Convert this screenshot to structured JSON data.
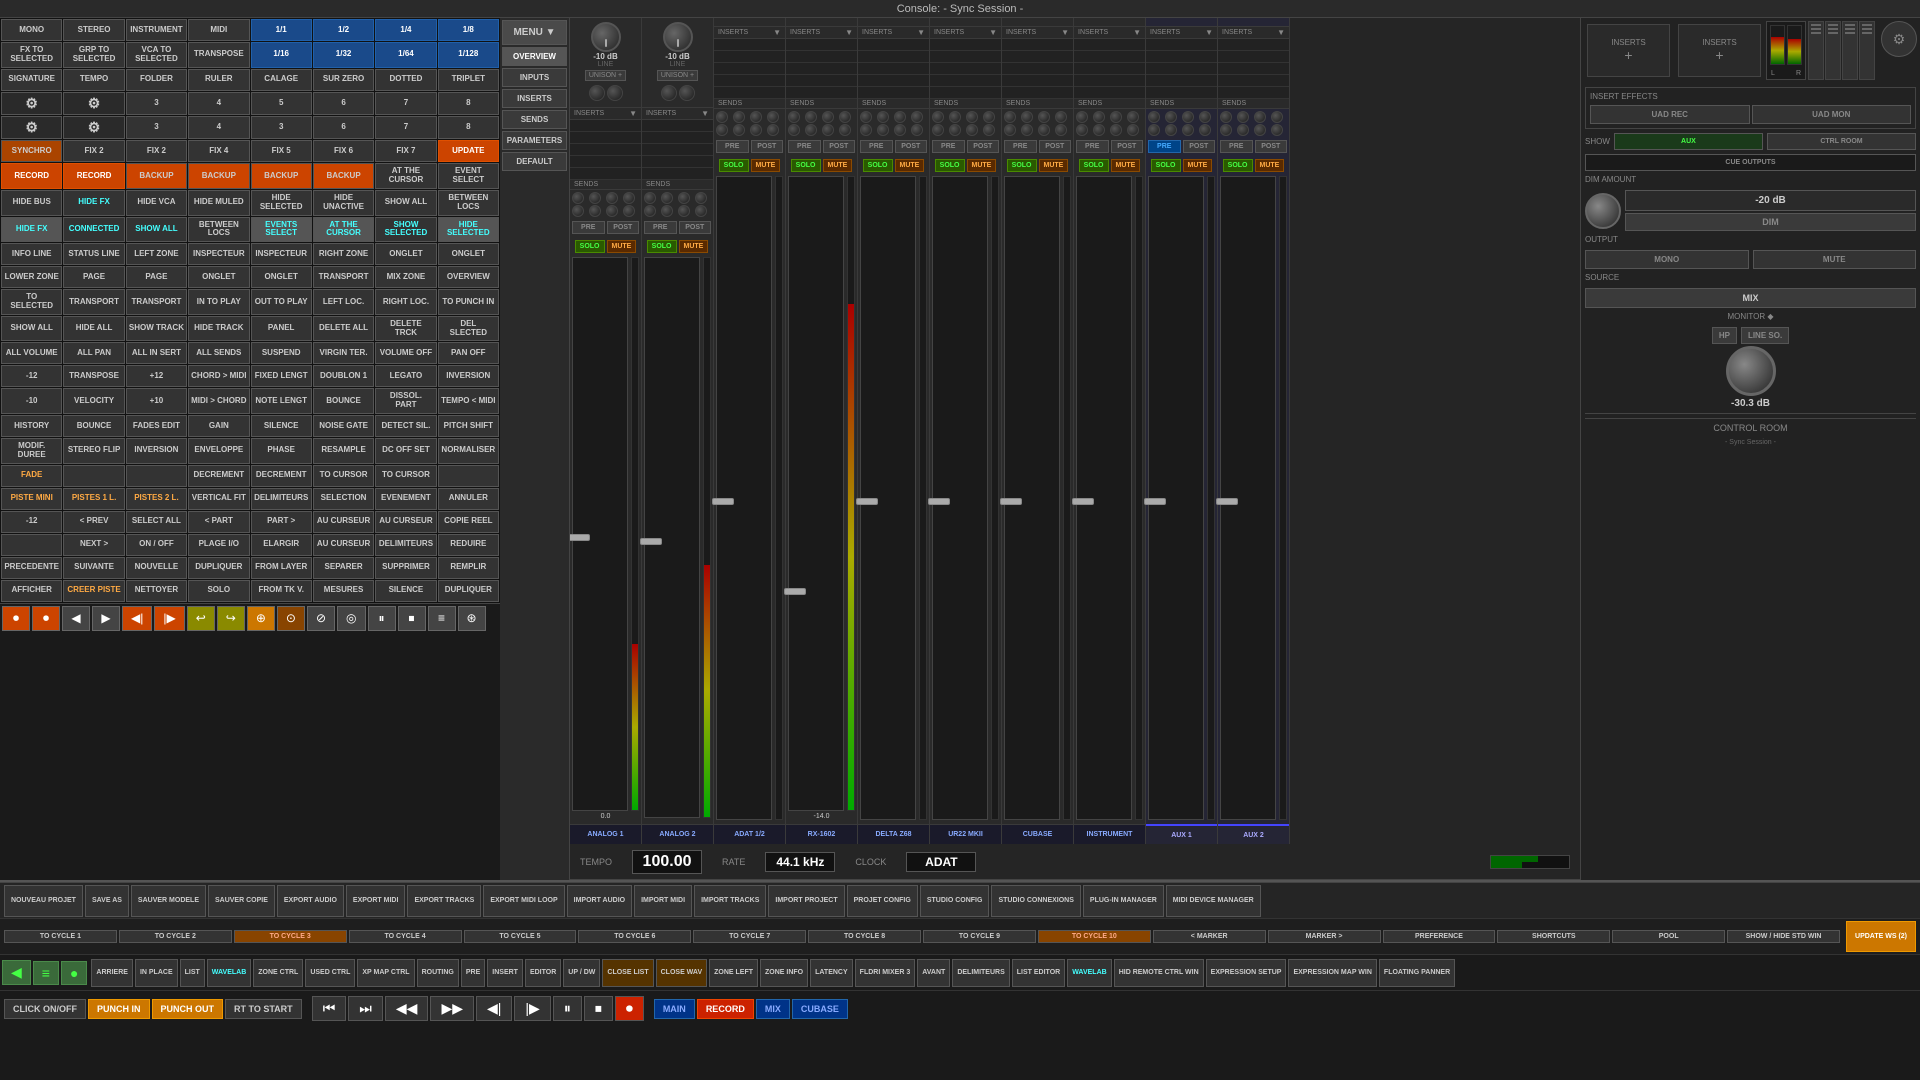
{
  "app": {
    "title": "Console: - Sync Session -",
    "topbar_color": "#2a2a2a"
  },
  "left_panel": {
    "rows": [
      [
        "MONO",
        "STEREO",
        "INSTRUMENT",
        "MIDI",
        "1/1",
        "1/2",
        "1/4",
        "1/8"
      ],
      [
        "FX TO Selected",
        "GRP TO Selected",
        "VCA TO Selected",
        "TRANSPOSE",
        "1/16",
        "1/32",
        "1/64",
        "1/128"
      ],
      [
        "SIGNATURE",
        "TEMPO",
        "FOLDER",
        "RULER",
        "CALAGE",
        "SUR ZERO",
        "DOTTED",
        "TRIPLET"
      ],
      [
        "⚙",
        "⚙",
        "3",
        "4",
        "5",
        "6",
        "7",
        "8"
      ],
      [
        "⚙",
        "⚙",
        "3",
        "4",
        "3",
        "6",
        "7",
        "8"
      ],
      [
        "SYNCHRO",
        "Fix 2",
        "Fix 2",
        "Fix 4",
        "Fix 5",
        "Fix 6",
        "Fix 7",
        "UPDATE"
      ],
      [
        "RECORD",
        "RECORD",
        "BACKUP",
        "BACKUP",
        "BACKUP",
        "BACKUP",
        "At The Cursor",
        "Event Select"
      ],
      [
        "Hide BUS",
        "Hide FX",
        "Hide VCA",
        "Hide Muled",
        "Hide Selected",
        "Hide Unactive",
        "Show All",
        "Between Locs"
      ],
      [
        "Hide FX",
        "Connected",
        "Show All",
        "Between Locs",
        "Events Select",
        "At The Cursor",
        "Show Selected",
        "Hide Selected"
      ],
      [
        "INFO LINE",
        "STATUS LINE",
        "LEFT ZONE",
        "INSPECTEUR",
        "INSPECTEUR",
        "RIGHT ZONE",
        "ONGLET",
        "ONGLET"
      ],
      [
        "LOWER ZONE",
        "PAGE",
        "PAGE",
        "ONGLET",
        "ONGLET",
        "TRANSPORT",
        "MIX ZONE",
        "OVERVIEW"
      ],
      [
        "TO SELECTED",
        "TRANSPORT",
        "TRANSPORT",
        "IN TO PLAY",
        "OUT TO PLAY",
        "LEFT LOC.",
        "RIGHT LOC.",
        "TO PUNCH IN"
      ],
      [
        "SHOW ALL",
        "HIDE ALL",
        "SHOW TRACK",
        "HIDE TRACK",
        "PANEL",
        "DELETE ALL",
        "DELETE TRCK",
        "DEL SLECTED"
      ],
      [
        "ALL VOLUME",
        "ALL PAN",
        "ALL IN SERT",
        "ALL SENDS",
        "SUSPEND",
        "VIRGIN TER.",
        "VOLUME OFF",
        "PAN OFF"
      ],
      [
        "-12",
        "TRANSPOSE",
        "+12",
        "CHORD > MIDI",
        "FIXED LENGT",
        "DOUBLON 1",
        "LEGATO",
        "INVERSION"
      ],
      [
        "-10",
        "VELOCITY",
        "+10",
        "MIDI > CHORD",
        "NOTE LENGT",
        "BOUNCE",
        "DISSOL. PART",
        "TEMPO < MIDI"
      ],
      [
        "HISTORY",
        "BOUNCE",
        "FADES EDIT",
        "GAIN",
        "SILENCE",
        "NOISE GATE",
        "DETECT SIL.",
        "PITCH SHIFT"
      ],
      [
        "MODIF. DUREE",
        "STEREO FLIP",
        "INVERSION",
        "ENVELOPPE",
        "PHASE",
        "RESAMPLE",
        "DC OFF SET",
        "NORMALISER"
      ],
      [
        "FADE",
        "",
        "",
        "DECREMENT",
        "DECREMENT",
        "TO CURSOR",
        "TO CURSOR",
        ""
      ],
      [
        "PISTE MINI",
        "PISTES 1 L.",
        "PISTES 2 L.",
        "VERTICAL FIT",
        "DELIMITEURS",
        "SELECTION",
        "EVENEMENT",
        "ANNULER"
      ],
      [
        "-12",
        "< PREV",
        "SELECT ALL",
        "< PART",
        "PART >",
        "AU CURSEUR",
        "AU CURSEUR",
        "COPIE REEL"
      ],
      [
        "",
        "NEXT >",
        "ON / OFF",
        "PLAGE I/O",
        "ELARGIR",
        "AU CURSEUR",
        "DELIMITEURS",
        "REDUIRE"
      ],
      [
        "PRECEDENTE",
        "SUIVANTE",
        "NOUVELLE",
        "DUPLIQUER",
        "FROM LAYER",
        "SEPARER",
        "SUPPRIMER",
        "REMPLIR"
      ],
      [
        "AFFICHER",
        "CREER PISTE",
        "NETTOYER",
        "SOLO",
        "FROM TK V.",
        "MESURES",
        "SILENCE",
        "DUPLIQUER"
      ]
    ],
    "row_styles": [
      [
        "",
        "",
        "",
        "",
        "blue",
        "blue",
        "blue",
        "blue"
      ],
      [
        "",
        "",
        "",
        "",
        "blue",
        "blue",
        "blue",
        "blue"
      ],
      [
        "",
        "",
        "",
        "",
        "",
        "",
        "",
        ""
      ],
      [
        "icon-btn",
        "icon-btn",
        "",
        "",
        "",
        "",
        "",
        ""
      ],
      [
        "icon-btn",
        "icon-btn",
        "",
        "",
        "",
        "",
        "",
        ""
      ],
      [
        "",
        "",
        "",
        "",
        "",
        "",
        "",
        "orange"
      ],
      [
        "orange",
        "orange",
        "",
        "",
        "",
        "",
        "",
        ""
      ],
      [
        "",
        "",
        "",
        "",
        "",
        "",
        "",
        ""
      ],
      [
        "cyan",
        "",
        "",
        "",
        "cyan",
        "cyan",
        "",
        "cyan"
      ],
      [
        "",
        "",
        "",
        "",
        "",
        "",
        "",
        ""
      ],
      [
        "",
        "",
        "",
        "",
        "",
        "",
        "",
        ""
      ],
      [
        "",
        "",
        "",
        "",
        "",
        "",
        "",
        ""
      ],
      [
        "",
        "",
        "",
        "",
        "",
        "",
        "",
        ""
      ],
      [
        "",
        "",
        "",
        "",
        "",
        "",
        "",
        ""
      ],
      [
        "",
        "",
        "",
        "",
        "",
        "",
        "",
        ""
      ],
      [
        "",
        "",
        "",
        "",
        "",
        "",
        "",
        ""
      ],
      [
        "",
        "",
        "",
        "",
        "",
        "",
        "",
        ""
      ],
      [
        "",
        "",
        "",
        "",
        "",
        "",
        "",
        ""
      ],
      [
        "",
        "",
        "",
        "",
        "",
        "",
        "",
        ""
      ],
      [
        "",
        "",
        "",
        "",
        "",
        "",
        "",
        ""
      ],
      [
        "",
        "",
        "",
        "",
        "",
        "",
        "",
        ""
      ],
      [
        "",
        "",
        "",
        "",
        "",
        "",
        "",
        ""
      ],
      [
        "",
        "",
        "",
        "",
        "",
        "",
        "",
        ""
      ],
      [
        "",
        "",
        "",
        "",
        "",
        "",
        "",
        ""
      ]
    ],
    "transport": {
      "buttons": [
        "⏮",
        "⏭",
        "◀◀",
        "▶▶",
        "◀",
        "▶",
        "⏺",
        "⏹",
        "⏺"
      ]
    }
  },
  "overview_sidebar": {
    "buttons": [
      "MENU ▼",
      "OVERVIEW",
      "INPUTS",
      "INSERTS",
      "SENDS",
      "PARAMETERS",
      "DEFAULT"
    ]
  },
  "channels": [
    {
      "name": "ANALOG 1",
      "type": "input",
      "level": "-10 dB",
      "selected": false,
      "vu": 30,
      "fader": 50,
      "color": "normal"
    },
    {
      "name": "ANALOG 2",
      "type": "input",
      "level": "-10 dB",
      "selected": false,
      "vu": 45,
      "fader": 50,
      "color": "normal"
    },
    {
      "name": "ADAT 1/2",
      "type": "input",
      "level": "",
      "selected": false,
      "vu": 0,
      "fader": 50,
      "color": "normal"
    },
    {
      "name": "RX-1602",
      "type": "input",
      "level": "",
      "selected": false,
      "vu": 80,
      "fader": 35,
      "color": "normal"
    },
    {
      "name": "DELTA Z68",
      "type": "input",
      "level": "",
      "selected": false,
      "vu": 0,
      "fader": 50,
      "color": "normal"
    },
    {
      "name": "UR22 MKII",
      "type": "input",
      "level": "",
      "selected": false,
      "vu": 0,
      "fader": 50,
      "color": "normal"
    },
    {
      "name": "CUBASE",
      "type": "input",
      "level": "",
      "selected": false,
      "vu": 0,
      "fader": 50,
      "color": "normal"
    },
    {
      "name": "INSTRUMENT",
      "type": "input",
      "level": "",
      "selected": false,
      "vu": 0,
      "fader": 50,
      "color": "normal"
    },
    {
      "name": "AUX 1",
      "type": "aux",
      "level": "",
      "selected": true,
      "vu": 0,
      "fader": 50,
      "color": "aux"
    },
    {
      "name": "AUX 2",
      "type": "aux",
      "level": "",
      "selected": false,
      "vu": 0,
      "fader": 50,
      "color": "aux"
    }
  ],
  "right_panel": {
    "insert_effects_label": "INSERT EFFECTS",
    "uad_buttons": [
      "UAD REC",
      "UAD MON"
    ],
    "show_label": "SHOW",
    "ctrl_room_label": "CTRL ROOM",
    "cue_outputs_label": "CUE OUTPUTS",
    "dim_amount_label": "DIM AMOUNT",
    "dim_value": "-20 dB",
    "dim_label": "DIM",
    "output_label": "OUTPUT",
    "mono_label": "MONO",
    "mute_label": "MUTE",
    "source_label": "SOURCE",
    "mix_label": "MIX",
    "monitor_label": "MONITOR ◆",
    "hp_label": "HP",
    "line_label": "LINE SO.",
    "monitor_db": "-30.3 dB",
    "control_room_label": "CONTROL ROOM",
    "sessions_label": "- Sync Session -",
    "lr_labels": [
      "L",
      "R"
    ]
  },
  "bottom_bar": {
    "tempo_label": "TEMPO",
    "tempo_value": "100.00",
    "rate_label": "RATE",
    "rate_value": "44.1 kHz",
    "clock_label": "CLOCK",
    "clock_value": "ADAT",
    "action_buttons": [
      "NOUVEAU PROJET",
      "SAVE AS",
      "SAUVER MODELE",
      "SAUVER COPIE",
      "EXPORT AUDIO",
      "EXPORT MIDI",
      "EXPORT TRACKS",
      "EXPORT MIDI LOOP",
      "IMPORT AUDIO",
      "IMPORT MIDI",
      "IMPORT TRACKS",
      "IMPORT PROJECT",
      "PROJET CONFIG",
      "STUDIO CONFIG",
      "STUDIO CONNEXIONS",
      "PLUG-IN MANAGER",
      "MIDI DEVICE MANAGER"
    ],
    "cycle_buttons": [
      "TO CYCLE 1",
      "TO CYCLE 2",
      "TO CYCLE 3",
      "TO CYCLE 4",
      "TO CYCLE 5",
      "TO CYCLE 6",
      "TO CYCLE 7",
      "TO CYCLE 8",
      "TO CYCLE 9",
      "TO CYCLE 10",
      "< MARKER",
      "MARKER >",
      "PREFERENCE",
      "SHORTCUTS",
      "POOL",
      "SHOW / HIDE STD WIN"
    ],
    "bottom_row_buttons": [
      "ARRIERE",
      "IN PLACE",
      "LIST",
      "WAVELAB",
      "ZONE CTRL",
      "USED CTRL",
      "XP MAP CTRL",
      "ROUTING",
      "PRE",
      "INSERT",
      "EDITOR",
      "UP / DW",
      "CLOSE LIST",
      "CLOSE WAV",
      "ZONE LEFT",
      "ZONE INFO",
      "LATENCY",
      "FLDRI MIXER 3",
      "AVANT",
      "DELIMITEURS",
      "LIST EDITOR",
      "WAVELAB",
      "",
      "HID REMOTE CTRL WIN",
      "EXPRESSION SETUP",
      "EXPRESSION MAP WIN",
      "FLOATING PANNER"
    ],
    "transport_controls": [
      "⏮",
      "⏭",
      "◀◀",
      "▶▶",
      "◀",
      "▶",
      "⏸",
      "⏹",
      "⏺"
    ],
    "special_buttons": [
      "CLICK ON/OFF",
      "PUNCH IN",
      "PUNCH OUT",
      "RT TO START"
    ],
    "update_ws": "UPDATE WS (2)",
    "main_label": "MAIN",
    "record_label": "RECORD",
    "mix_label": "MIX",
    "cubase_label": "CUBASE"
  }
}
